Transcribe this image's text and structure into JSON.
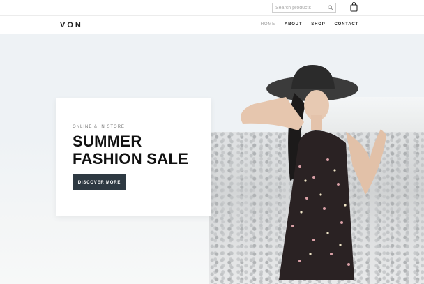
{
  "header": {
    "search": {
      "placeholder": "Search products",
      "icon": "search-icon"
    },
    "cart": {
      "icon": "shopping-bag-icon"
    }
  },
  "nav": {
    "logo": "VON",
    "items": [
      {
        "label": "HOME",
        "active": true
      },
      {
        "label": "ABOUT",
        "active": false
      },
      {
        "label": "SHOP",
        "active": false
      },
      {
        "label": "CONTACT",
        "active": false
      }
    ]
  },
  "hero": {
    "eyebrow": "ONLINE & IN STORE",
    "headline_line1": "SUMMER",
    "headline_line2": "FASHION SALE",
    "cta_label": "DISCOVER MORE",
    "cta_color": "#2e3942"
  }
}
